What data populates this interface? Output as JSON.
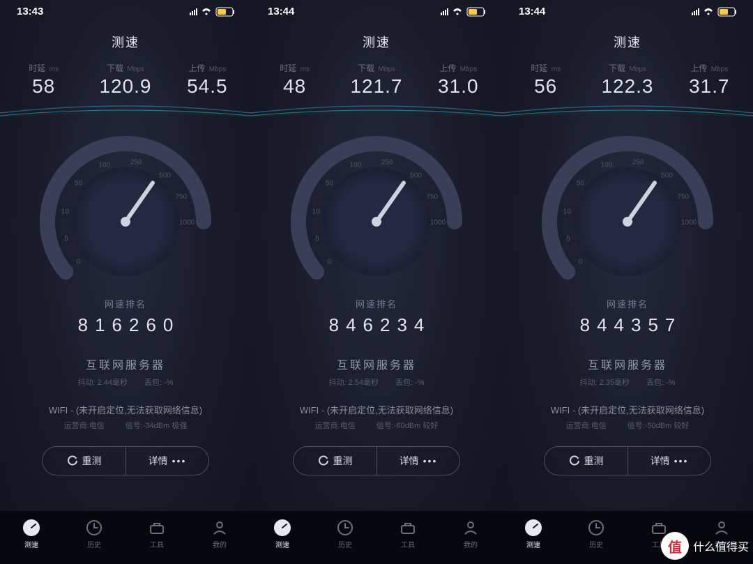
{
  "watermark": "什么值得买",
  "watermark_badge": "值",
  "common": {
    "title": "测速",
    "ping_label": "时延",
    "ping_unit": "ms",
    "down_label": "下载",
    "down_unit": "Mbps",
    "up_label": "上传",
    "up_unit": "Mbps",
    "rank_label": "网速排名",
    "server_title": "互联网服务器",
    "jitter_label": "抖动:",
    "loss_label": "丢包:",
    "loss_value": "-%",
    "wifi_prefix": "WIFI -",
    "wifi_note": "(未开启定位,无法获取网络信息)",
    "carrier_label": "运营商:电信",
    "signal_label_prefix": "信号:",
    "retest": "重测",
    "details": "详情",
    "gauge_ticks": [
      "0",
      "5",
      "10",
      "50",
      "100",
      "250",
      "500",
      "750",
      "1000"
    ],
    "tabs": [
      {
        "label": "测速"
      },
      {
        "label": "历史"
      },
      {
        "label": "工具"
      },
      {
        "label": "我的"
      }
    ]
  },
  "screens": [
    {
      "time": "13:43",
      "ping": "58",
      "down": "120.9",
      "up": "54.5",
      "rank": "816260",
      "jitter_value": "2.44毫秒",
      "signal": "-34dBm 极强"
    },
    {
      "time": "13:44",
      "ping": "48",
      "down": "121.7",
      "up": "31.0",
      "rank": "846234",
      "jitter_value": "2.54毫秒",
      "signal": "-60dBm 较好"
    },
    {
      "time": "13:44",
      "ping": "56",
      "down": "122.3",
      "up": "31.7",
      "rank": "844357",
      "jitter_value": "2.35毫秒",
      "signal": "-50dBm 较好"
    }
  ]
}
